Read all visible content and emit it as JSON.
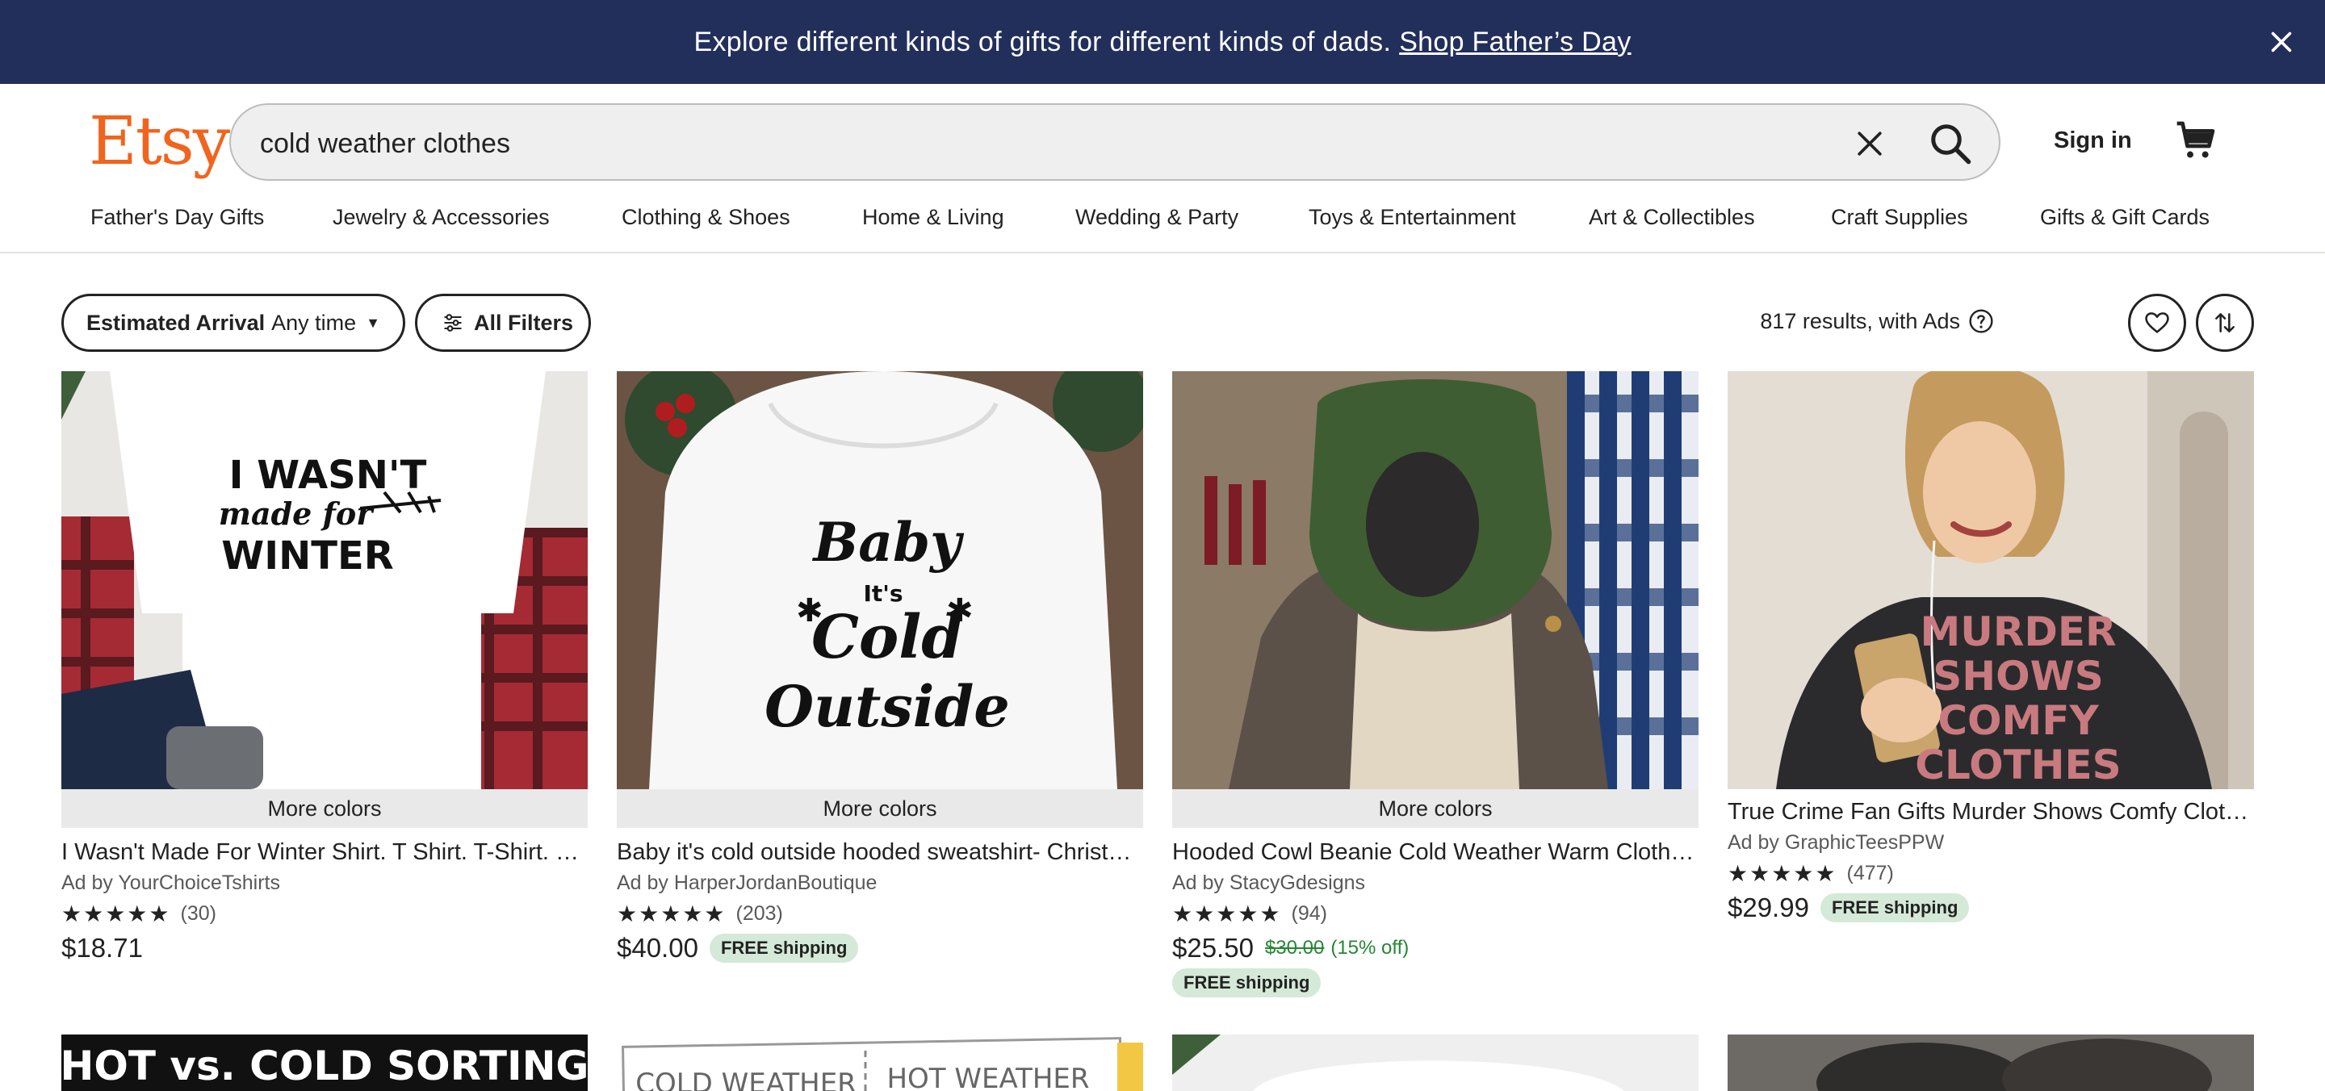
{
  "banner": {
    "text": "Explore different kinds of gifts for different kinds of dads.",
    "link": "Shop Father’s Day"
  },
  "header": {
    "logo": "Etsy",
    "search_value": "cold weather clothes",
    "signin": "Sign in"
  },
  "nav": [
    "Father's Day Gifts",
    "Jewelry & Accessories",
    "Clothing & Shoes",
    "Home & Living",
    "Wedding & Party",
    "Toys & Entertainment",
    "Art & Collectibles",
    "Craft Supplies",
    "Gifts & Gift Cards"
  ],
  "filters": {
    "arrival_label": "Estimated Arrival",
    "arrival_value": "Any time",
    "all_filters": "All Filters",
    "results": "817 results, with Ads"
  },
  "listings": [
    {
      "more": "More colors",
      "title": "I Wasn't Made For Winter Shirt. T Shirt. T-Shirt. Winter Shirt. Cold Weather Shirt",
      "seller": "Ad by YourChoiceTshirts",
      "stars": "★★★★★",
      "reviews": "(30)",
      "price": "$18.71",
      "original": "",
      "discount": "",
      "shipping": ""
    },
    {
      "more": "More colors",
      "title": "Baby it's cold outside hooded sweatshirt- Christmas hoodie",
      "seller": "Ad by HarperJordanBoutique",
      "stars": "★★★★★",
      "reviews": "(203)",
      "price": "$40.00",
      "original": "",
      "discount": "",
      "shipping": "FREE shipping"
    },
    {
      "more": "More colors",
      "title": "Hooded Cowl Beanie Cold Weather Warm Clothing",
      "seller": "Ad by StacyGdesigns",
      "stars": "★★★★★",
      "reviews": "(94)",
      "price": "$25.50",
      "original": "$30.00",
      "discount": "(15% off)",
      "shipping": "FREE shipping"
    },
    {
      "more": "",
      "title": "True Crime Fan Gifts Murder Shows Comfy Clothes Sweatshirt",
      "seller": "Ad by GraphicTeesPPW",
      "stars": "★★★★★",
      "reviews": "(477)",
      "price": "$29.99",
      "original": "",
      "discount": "",
      "shipping": "FREE shipping"
    }
  ],
  "images": {
    "shirt1": [
      "I WASN'T",
      "made for",
      "WINTER"
    ],
    "hoodie": [
      "Baby",
      "It's",
      "Cold",
      "Outside"
    ],
    "sweatshirt": [
      "MURDER",
      "SHOWS",
      "COMFY",
      "CLOTHES"
    ],
    "bottom1": "HOT vs. COLD SORTING",
    "bottom2a": "COLD WEATHER",
    "bottom2b": "HOT WEATHER"
  },
  "colors": {
    "banner_bg": "#232f5b",
    "logo": "#f1641e",
    "free_ship_bg": "#d4e9d7",
    "discount": "#258635"
  }
}
